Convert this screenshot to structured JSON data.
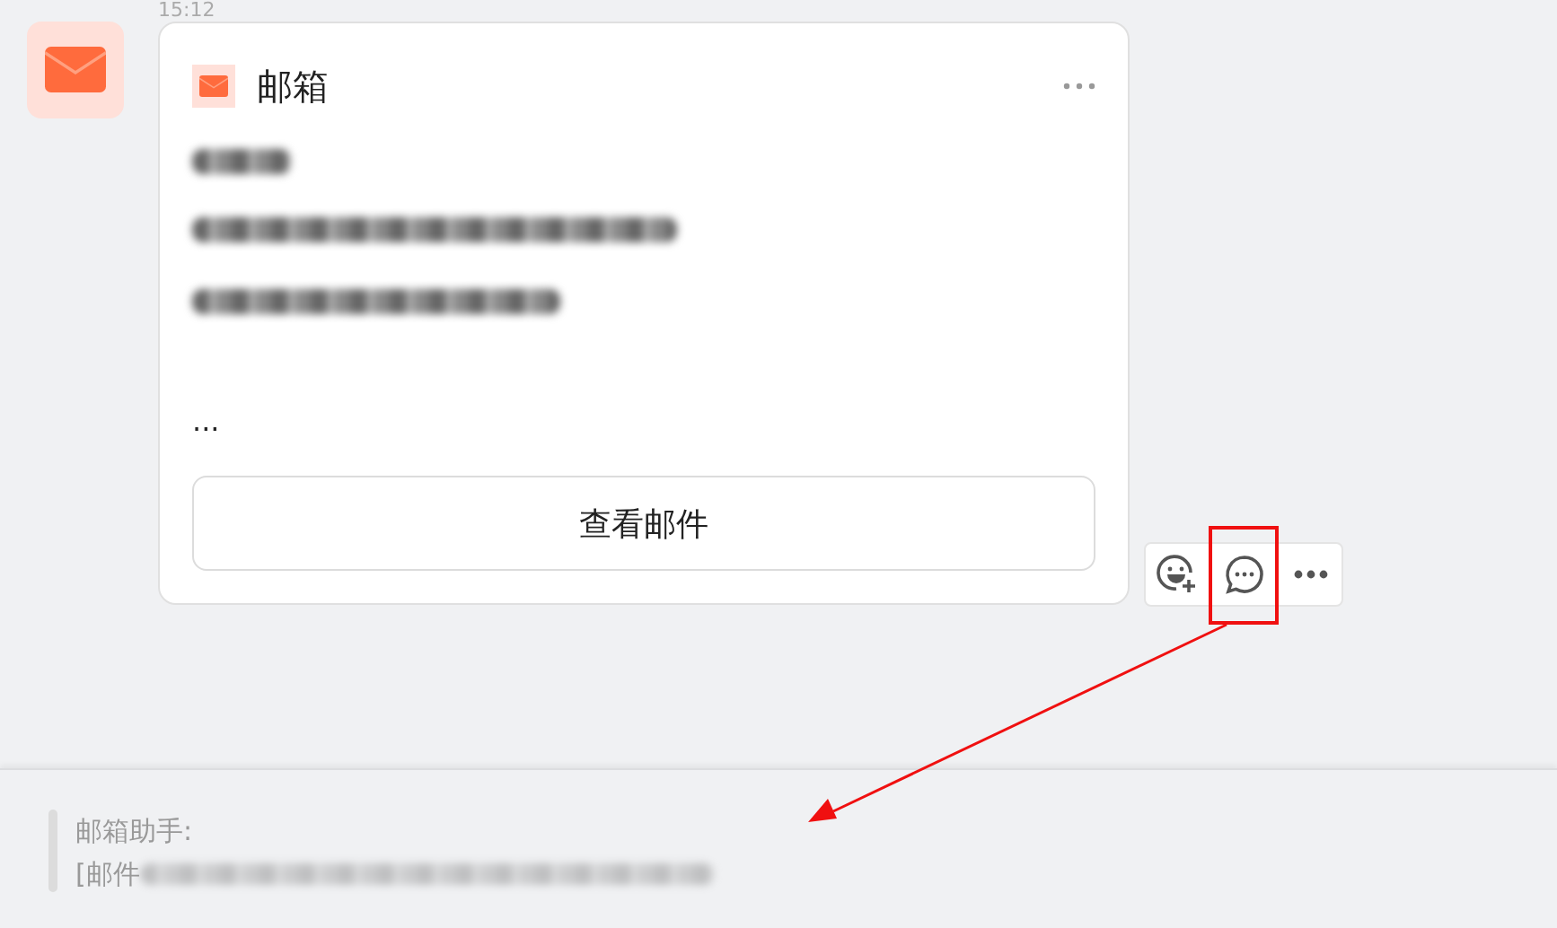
{
  "timestamp": "15:12",
  "card": {
    "title": "邮箱",
    "ellipsis": "...",
    "button": "查看邮件"
  },
  "actions": [
    {
      "kind": "emoji-add",
      "highlighted": false
    },
    {
      "kind": "reply",
      "highlighted": true
    },
    {
      "kind": "more",
      "highlighted": false
    }
  ],
  "quote": {
    "author": "邮箱助手:",
    "text": "[邮件"
  }
}
